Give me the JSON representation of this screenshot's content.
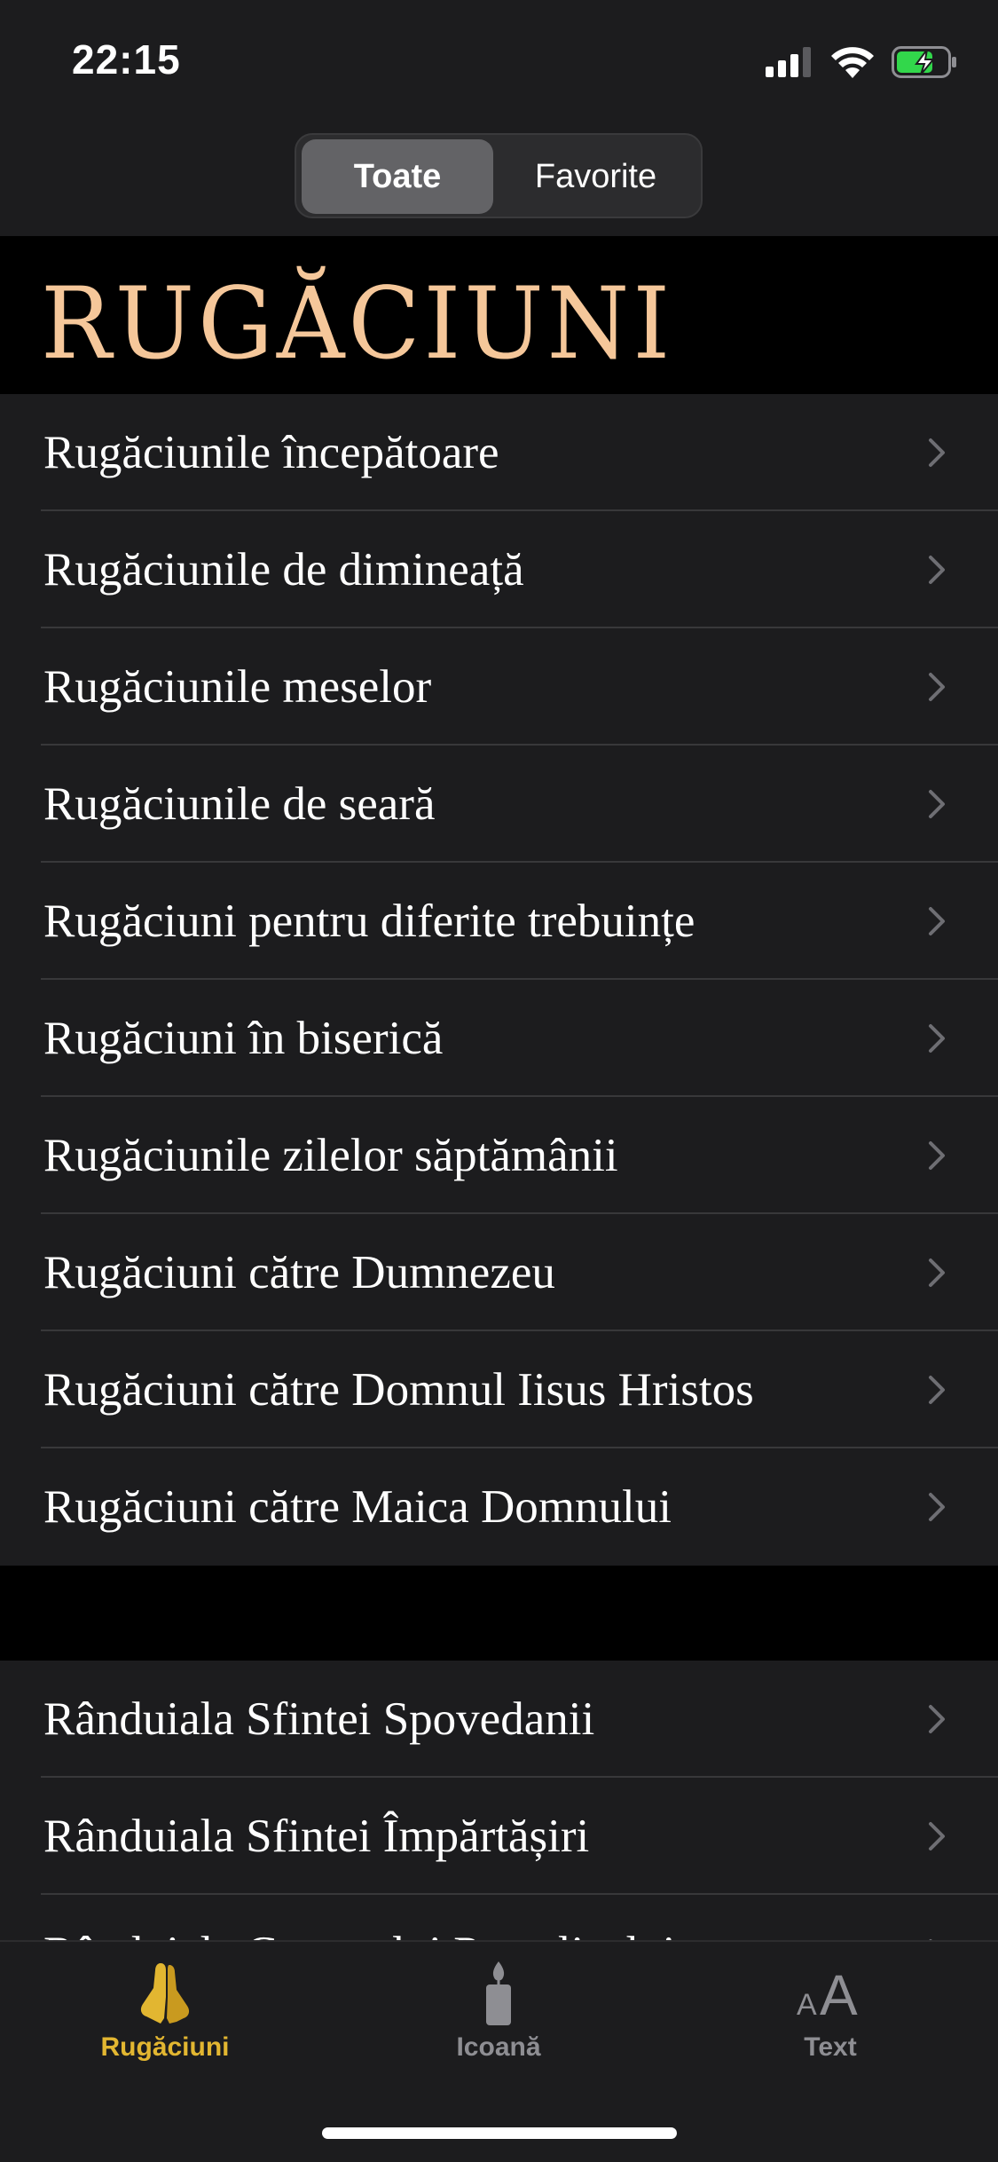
{
  "status_bar": {
    "time": "22:15"
  },
  "segmented_control": {
    "all_label": "Toate",
    "favorites_label": "Favorite"
  },
  "banner": {
    "title": "RUGĂCIUNI"
  },
  "list_main": {
    "items": [
      {
        "label": "Rugăciunile începătoare"
      },
      {
        "label": "Rugăciunile de dimineață"
      },
      {
        "label": "Rugăciunile meselor"
      },
      {
        "label": "Rugăciunile de seară"
      },
      {
        "label": "Rugăciuni pentru diferite trebuințe"
      },
      {
        "label": "Rugăciuni în biserică"
      },
      {
        "label": "Rugăciunile zilelor săptămânii"
      },
      {
        "label": "Rugăciuni către Dumnezeu"
      },
      {
        "label": "Rugăciuni către Domnul Iisus Hristos"
      },
      {
        "label": "Rugăciuni către Maica Domnului"
      }
    ]
  },
  "list_services": {
    "items": [
      {
        "label": "Rânduiala Sfintei Spovedanii"
      },
      {
        "label": "Rânduiala Sfintei Împărtășiri"
      },
      {
        "label": "Rânduiala Canonului Paraclisului"
      }
    ]
  },
  "tab_bar": {
    "tabs": [
      {
        "label": "Rugăciuni",
        "icon": "praying-hands-icon",
        "active": true
      },
      {
        "label": "Icoană",
        "icon": "candle-icon",
        "active": false
      },
      {
        "label": "Text",
        "icon": "text-size-icon",
        "active": false
      }
    ]
  },
  "colors": {
    "accent": "#e2b631",
    "title": "#f5c79a",
    "background": "#1c1c1e",
    "battery": "#32d74b"
  }
}
